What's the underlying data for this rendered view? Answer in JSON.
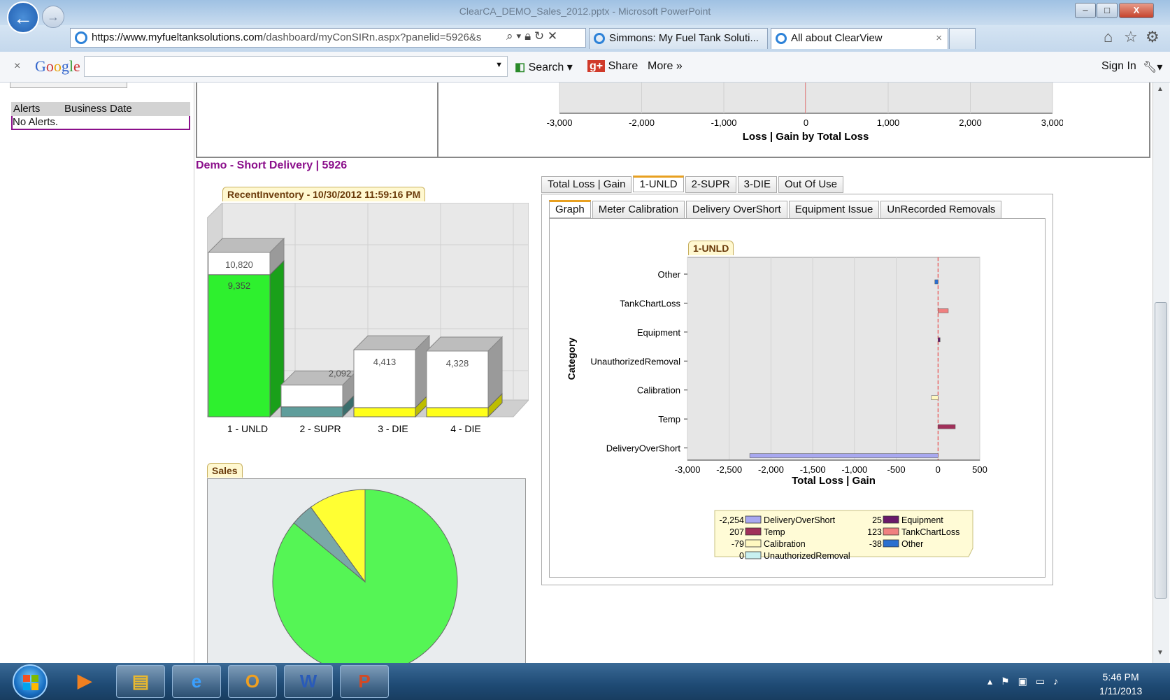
{
  "window": {
    "title": "ClearCA_DEMO_Sales_2012.pptx - Microsoft PowerPoint",
    "minimize": "–",
    "maximize": "□",
    "close": "X"
  },
  "nav": {
    "url_host": "https://www.myfueltanksolutions.com",
    "url_path": "/dashboard/myConSIRn.aspx?panelid=5926&s",
    "tabs": [
      {
        "label": "Simmons: My Fuel Tank Soluti..."
      },
      {
        "label": "All about ClearView",
        "close": "×"
      }
    ]
  },
  "google": {
    "logo": "Google",
    "close": "×",
    "search_label": "Search",
    "share_label": "Share",
    "more_label": "More »",
    "signin_label": "Sign In"
  },
  "alerts": {
    "col1": "Alerts",
    "col2": "Business Date",
    "empty": "No Alerts."
  },
  "top_chart": {
    "x_ticks": [
      "-3,000",
      "-2,000",
      "-1,000",
      "0",
      "1,000",
      "2,000",
      "3,000"
    ],
    "xlabel": "Loss | Gain by Total Loss"
  },
  "panel": {
    "title": "Demo - Short Delivery | 5926",
    "tabs": [
      "Total Loss | Gain",
      "1-UNLD",
      "2-SUPR",
      "3-DIE",
      "Out Of Use"
    ],
    "active_tab": 1,
    "subtabs": [
      "Graph",
      "Meter Calibration",
      "Delivery OverShort",
      "Equipment Issue",
      "UnRecorded Removals"
    ],
    "active_subtab": 0
  },
  "inventory_title": "RecentInventory - 10/30/2012 11:59:16 PM",
  "sales_title": "Sales",
  "colors": {
    "green": "#2ef02e",
    "teal": "#5f9d9b",
    "yellow": "#ffff1a",
    "purple": "#8b0f8b"
  },
  "chart_data": [
    {
      "type": "bar",
      "stacked": true,
      "categories": [
        "1 - UNLD",
        "2 - SUPR",
        "3 - DIE",
        "4 - DIE"
      ],
      "series": [
        {
          "values": [
            9352,
            650,
            600,
            600
          ]
        },
        {
          "values": [
            10820,
            2092,
            4413,
            4328
          ]
        }
      ],
      "labels": [
        {
          "filled": "9,352",
          "total": "10,820"
        },
        {
          "total": "2,092"
        },
        {
          "total": "4,413"
        },
        {
          "total": "4,328"
        }
      ],
      "title": "RecentInventory - 10/30/2012 11:59:16 PM"
    },
    {
      "type": "bar",
      "orientation": "horizontal",
      "title": "1-UNLD",
      "ylabel": "Category",
      "xlabel": "Total Loss | Gain",
      "categories": [
        "Other",
        "TankChartLoss",
        "Equipment",
        "UnauthorizedRemoval",
        "Calibration",
        "Temp",
        "DeliveryOverShort"
      ],
      "values": [
        -38,
        123,
        25,
        0,
        -79,
        207,
        -2254
      ],
      "xlim": [
        -3000,
        500
      ],
      "x_ticks": [
        "-3,000",
        "-2,500",
        "-2,000",
        "-1,500",
        "-1,000",
        "-500",
        "0",
        "500"
      ],
      "bar_colors": [
        "#2a6fd0",
        "#f08080",
        "#6a1a6a",
        "#c8f0f0",
        "#fff8c0",
        "#a0305a",
        "#a8a8f0"
      ],
      "legend": [
        {
          "value": "-2,254",
          "name": "DeliveryOverShort",
          "color": "#a8a8f0"
        },
        {
          "value": "207",
          "name": "Temp",
          "color": "#a0305a"
        },
        {
          "value": "-79",
          "name": "Calibration",
          "color": "#fff8c0"
        },
        {
          "value": "0",
          "name": "UnauthorizedRemoval",
          "color": "#c8f0f0"
        },
        {
          "value": "25",
          "name": "Equipment",
          "color": "#6a1a6a"
        },
        {
          "value": "123",
          "name": "TankChartLoss",
          "color": "#f08080"
        },
        {
          "value": "-38",
          "name": "Other",
          "color": "#2a6fd0"
        }
      ]
    },
    {
      "type": "pie",
      "title": "Sales",
      "values": [
        86,
        4,
        10
      ],
      "colors": [
        "#55f555",
        "#7aa8a8",
        "#ffff33"
      ]
    }
  ],
  "taskbar": {
    "time": "5:46 PM",
    "date": "1/11/2013"
  }
}
